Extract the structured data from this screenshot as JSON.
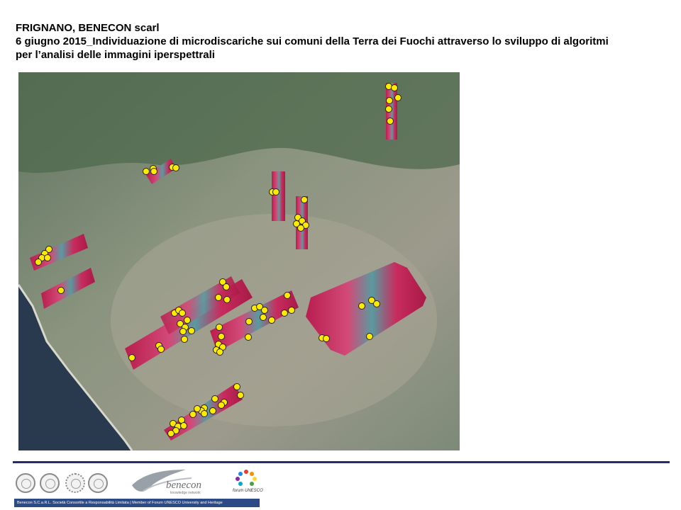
{
  "title": {
    "line1": "FRIGNANO, BENECON scarl",
    "line2": "6 giugno 2015_Individuazione di microdiscariche sui comuni della Terra dei Fuochi attraverso lo sviluppo di algoritmi",
    "line3": "per l’analisi delle immagini iperspettrali"
  },
  "logos": {
    "benecon_word": "benecon",
    "benecon_sub": "knowledge network",
    "forum_word": "forum UNESCO"
  },
  "footer": {
    "text": "Benecon S.C.a.R.L. Società Consortile a Responsabilità Limitata | Member of Forum UNESCO University and Heritage"
  },
  "colors": {
    "marker": "#ffeb00",
    "strip_red": "#c4245a",
    "footer_bar": "#2c4a86",
    "rule": "#1f2f6b"
  }
}
